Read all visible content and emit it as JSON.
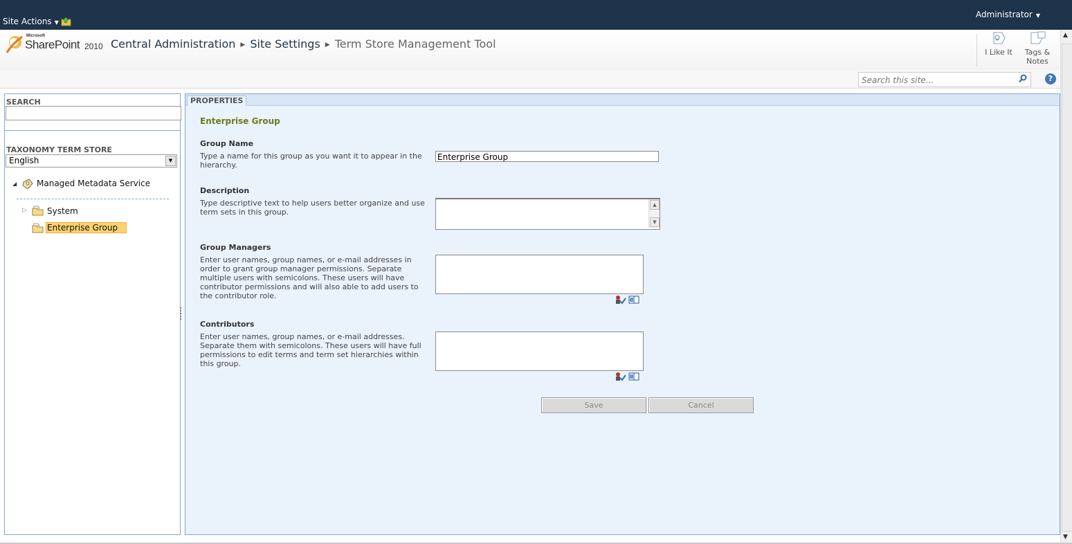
{
  "ribbon": {
    "site_actions_label": "Site Actions",
    "user_name": "Administrator",
    "colors": {
      "ribbon_bg": "#1e344b"
    }
  },
  "header": {
    "logo": {
      "brand_small": "Microsoft",
      "product": "SharePoint",
      "version": "2010"
    },
    "breadcrumb": [
      {
        "label": "Central Administration"
      },
      {
        "label": "Site Settings"
      },
      {
        "label": "Term Store Management Tool"
      }
    ],
    "social": {
      "like_label": "I Like It",
      "tags_label_1": "Tags &",
      "tags_label_2": "Notes"
    }
  },
  "site_search": {
    "placeholder": "Search this site...",
    "help_icon": "help-icon"
  },
  "left_panel": {
    "search_label": "SEARCH",
    "taxonomy_label": "TAXONOMY TERM STORE",
    "language_value": "English",
    "tree": {
      "root": "Managed Metadata Service",
      "children": [
        {
          "label": "System",
          "selected": false
        },
        {
          "label": "Enterprise Group",
          "selected": true
        }
      ]
    }
  },
  "properties": {
    "tab_label": "PROPERTIES",
    "title": "Enterprise Group",
    "group_name": {
      "label": "Group Name",
      "desc": "Type a name for this group as you want it to appear in the hierarchy.",
      "value": "Enterprise Group"
    },
    "description": {
      "label": "Description",
      "desc": "Type descriptive text to help users better organize and use term sets in this group."
    },
    "group_managers": {
      "label": "Group Managers",
      "desc": "Enter user names, group names, or e-mail addresses in order to grant group manager permissions. Separate multiple users with semicolons. These users will have contributor permissions and will also able to add users to the contributor role."
    },
    "contributors": {
      "label": "Contributors",
      "desc": "Enter user names, group names, or e-mail addresses. Separate them with semicolons. These users will have full permissions to edit terms and term set hierarchies within this group."
    },
    "save_label": "Save",
    "cancel_label": "Cancel",
    "colors": {
      "title_color": "#6b7b18",
      "panel_bg": "#eaf2fc",
      "border": "#7ea6cf"
    }
  }
}
